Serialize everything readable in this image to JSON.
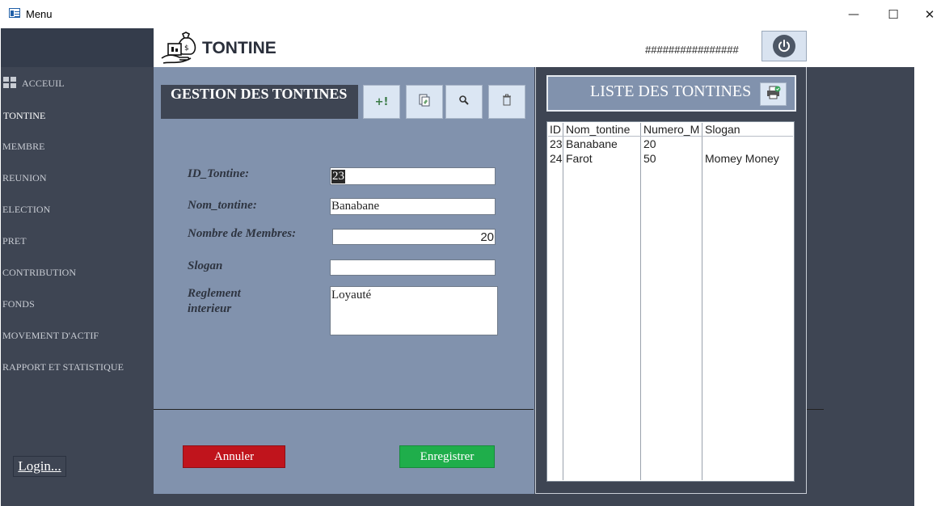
{
  "window": {
    "title": "Menu",
    "minimize": "—",
    "maximize": "☐",
    "close": "✕"
  },
  "header": {
    "brand": "TONTINE",
    "user_display": "################",
    "power_icon": "power-icon"
  },
  "sidebar": {
    "items": [
      {
        "label": "ACCEUIL"
      },
      {
        "label": "TONTINE"
      },
      {
        "label": "MEMBRE"
      },
      {
        "label": "REUNION"
      },
      {
        "label": "ELECTION"
      },
      {
        "label": "PRET"
      },
      {
        "label": "CONTRIBUTION"
      },
      {
        "label": "FONDS"
      },
      {
        "label": "MOVEMENT D'ACTIF"
      },
      {
        "label": "RAPPORT ET STATISTIQUE"
      }
    ],
    "login_label": "Login..."
  },
  "form": {
    "title": "GESTION DES TONTINES",
    "tools": {
      "add_label": "+!"
    },
    "fields": {
      "id": {
        "label": "ID_Tontine:",
        "value": "23"
      },
      "nom": {
        "label": "Nom_tontine:",
        "value": "Banabane"
      },
      "membres": {
        "label": "Nombre de Membres:",
        "value": "20"
      },
      "slogan": {
        "label": "Slogan",
        "value": ""
      },
      "reglement": {
        "label1": "Reglement",
        "label2": "interieur",
        "value": "Loyauté"
      }
    },
    "cancel_label": "Annuler",
    "save_label": "Enregistrer"
  },
  "list": {
    "title": "LISTE DES TONTINES",
    "columns": [
      "ID",
      "Nom_tontine",
      "Numero_M",
      "Slogan"
    ],
    "rows": [
      [
        "23",
        "Banabane",
        "20",
        ""
      ],
      [
        "24",
        "Farot",
        "50",
        "Momey Money"
      ]
    ]
  },
  "colors": {
    "sidebar": "#3e4553",
    "panel": "#8192ad",
    "cancel": "#c0141c",
    "save": "#1fae4b"
  }
}
